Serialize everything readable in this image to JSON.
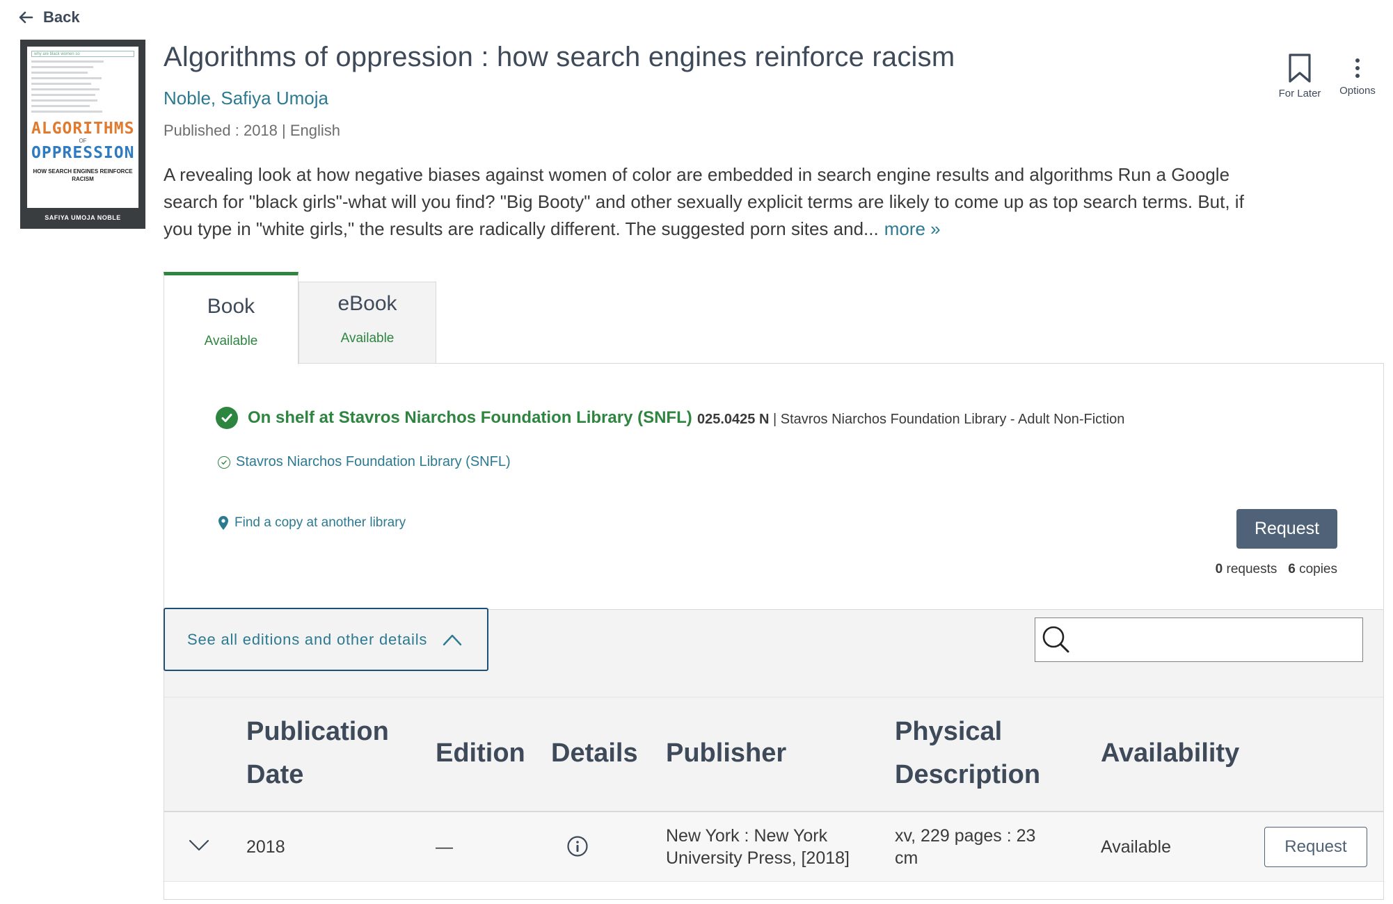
{
  "nav": {
    "back_label": "Back"
  },
  "cover": {
    "search_text": "why are black women so",
    "title_line1": "ALGORITHMS",
    "title_of": "OF",
    "title_line2": "OPPRESSION",
    "subtitle": "HOW SEARCH ENGINES REINFORCE RACISM",
    "author": "SAFIYA UMOJA NOBLE"
  },
  "record": {
    "title": "Algorithms of oppression : how search engines reinforce racism",
    "author": "Noble, Safiya Umoja",
    "published": "Published : 2018 | English",
    "description": "A revealing look at how negative biases against women of color are embedded in search engine results and algorithms Run a Google search for \"black girls\"-what will you find? \"Big Booty\" and other sexually explicit terms are likely to come up as top search terms. But, if you type in \"white girls,\" the results are radically different. The suggested porn sites and...",
    "more_label": "more »"
  },
  "actions": {
    "for_later_label": "For Later",
    "options_label": "Options"
  },
  "tabs": [
    {
      "label": "Book",
      "status": "Available"
    },
    {
      "label": "eBook",
      "status": "Available"
    }
  ],
  "availability": {
    "status_text": "On shelf at Stavros Niarchos Foundation Library (SNFL)",
    "call_number": "025.0425 N",
    "location": " | Stavros Niarchos Foundation Library - Adult Non-Fiction",
    "branch": "Stavros Niarchos Foundation Library (SNFL)",
    "find_copy_label": "Find a copy at another library",
    "request_label": "Request",
    "requests_count": "0",
    "requests_label": " requests",
    "copies_count": "6",
    "copies_label": " copies"
  },
  "editions": {
    "toggle_label": "See all editions and other details",
    "search_placeholder": "",
    "columns": {
      "pub_date_line1": "Publication",
      "pub_date_line2": "Date",
      "edition": "Edition",
      "details": "Details",
      "publisher": "Publisher",
      "physical_line1": "Physical",
      "physical_line2": "Description",
      "availability": "Availability"
    },
    "rows": [
      {
        "pub_date": "2018",
        "edition": "—",
        "publisher_line1": "New York : New York",
        "publisher_line2": "University Press, [2018]",
        "physical_line1": "xv, 229 pages : 23",
        "physical_line2": "cm",
        "availability": "Available",
        "request_label": "Request"
      }
    ]
  },
  "colors": {
    "accent_green": "#2e8540",
    "link_teal": "#2c7a91",
    "heading_slate": "#3e4a59",
    "button_slate": "#4f6278"
  }
}
